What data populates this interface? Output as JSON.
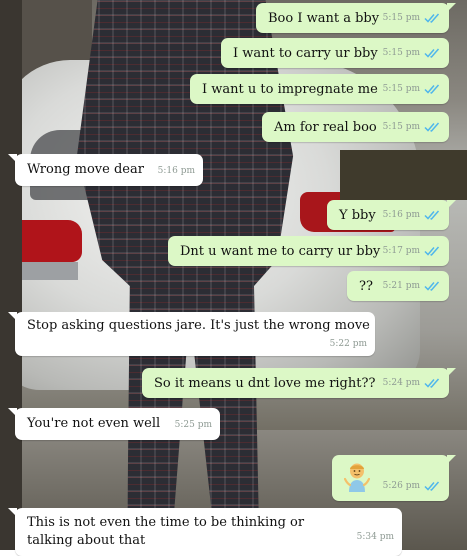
{
  "messages": [
    {
      "dir": "out",
      "text": "Boo I want a bby",
      "time": "5:15 pm",
      "ticks": "read"
    },
    {
      "dir": "out",
      "text": "I want to carry ur bby",
      "time": "5:15 pm",
      "ticks": "read"
    },
    {
      "dir": "out",
      "text": "I want u to impregnate me",
      "time": "5:15 pm",
      "ticks": "read"
    },
    {
      "dir": "out",
      "text": "Am for real boo",
      "time": "5:15 pm",
      "ticks": "read"
    },
    {
      "dir": "in",
      "text": "Wrong move dear",
      "time": "5:16 pm"
    },
    {
      "dir": "out",
      "text": "Y bby",
      "time": "5:16 pm",
      "ticks": "read"
    },
    {
      "dir": "out",
      "text": "Dnt u want me to carry ur bby",
      "time": "5:17 pm",
      "ticks": "read"
    },
    {
      "dir": "out",
      "text": "??",
      "time": "5:21 pm",
      "ticks": "read"
    },
    {
      "dir": "in",
      "text": "Stop asking questions jare. It's just the wrong move",
      "time": "5:22 pm"
    },
    {
      "dir": "out",
      "text": "So it means u dnt love me right??",
      "time": "5:24 pm",
      "ticks": "read"
    },
    {
      "dir": "in",
      "text": "You're not even well",
      "time": "5:25 pm"
    },
    {
      "dir": "out",
      "text": "",
      "emoji": "person-shrugging-emoji",
      "time": "5:26 pm",
      "ticks": "read"
    },
    {
      "dir": "in",
      "text": "This is not even the time to be thinking or talking about that",
      "time": "5:34 pm"
    }
  ],
  "colors": {
    "outgoing_bubble": "#dcf8c6",
    "incoming_bubble": "#ffffff",
    "read_ticks": "#4fb6ec",
    "timestamp": "#8e9a93"
  }
}
